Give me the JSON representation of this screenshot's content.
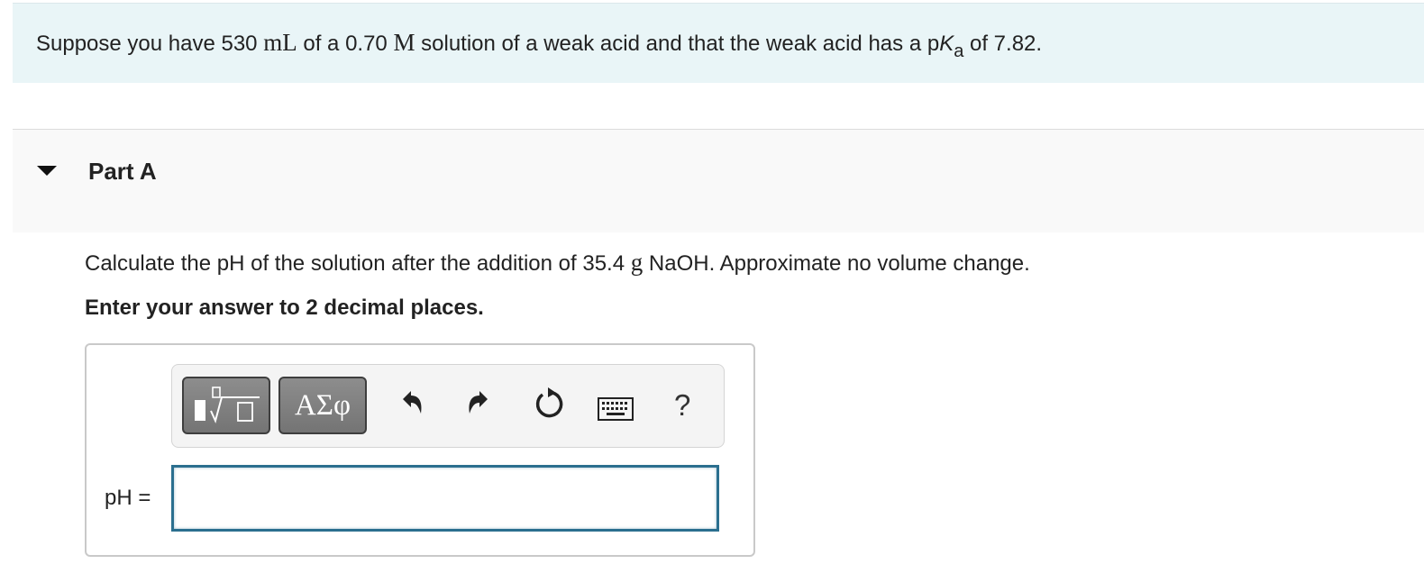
{
  "intro": {
    "before_volume": "Suppose you have 530 ",
    "volume_unit": "mL",
    "between_unit_conc": " of a 0.70 ",
    "conc_unit": "M",
    "middle": " solution of a weak acid and that the weak acid has a p",
    "k_symbol": "K",
    "k_sub": "a",
    "tail": " of 7.82."
  },
  "part": {
    "title": "Part A"
  },
  "question": {
    "before_mass": "Calculate the pH of the solution after the addition of 35.4 ",
    "mass_unit": "g",
    "after_mass": " NaOH.  Approximate no volume change."
  },
  "instruction": "Enter your answer to 2 decimal places.",
  "toolbar": {
    "templates_icon": "templates-sqrt-icon",
    "greek_label": "ΑΣφ",
    "undo_icon": "undo-icon",
    "redo_icon": "redo-icon",
    "reset_icon": "reset-icon",
    "keyboard_icon": "keyboard-icon",
    "help_label": "?"
  },
  "answer": {
    "label": "pH =",
    "value": ""
  },
  "colors": {
    "intro_bg": "#e9f5f7",
    "part_bg": "#f9f9f9",
    "input_border": "#2b6f8f"
  }
}
